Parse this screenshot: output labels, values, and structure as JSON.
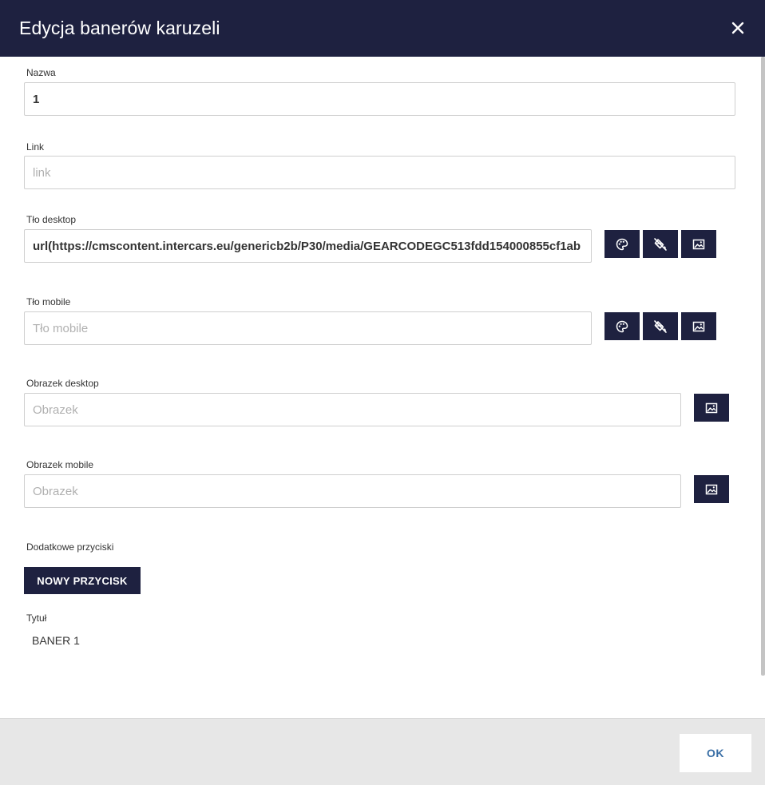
{
  "dialog": {
    "title": "Edycja banerów karuzeli"
  },
  "fields": {
    "nazwa": {
      "label": "Nazwa",
      "value": "1"
    },
    "link": {
      "label": "Link",
      "placeholder": "link"
    },
    "tlo_desktop": {
      "label": "Tło desktop",
      "value": "url(https://cmscontent.intercars.eu/genericb2b/P30/media/GEARCODEGC513fdd154000855cf1ab",
      "buttons": [
        "palette-icon",
        "fill-off-icon",
        "image-icon"
      ]
    },
    "tlo_mobile": {
      "label": "Tło mobile",
      "placeholder": "Tło mobile",
      "buttons": [
        "palette-icon",
        "fill-off-icon",
        "image-icon"
      ]
    },
    "obrazek_desktop": {
      "label": "Obrazek desktop",
      "placeholder": "Obrazek",
      "buttons": [
        "image-icon"
      ]
    },
    "obrazek_mobile": {
      "label": "Obrazek mobile",
      "placeholder": "Obrazek",
      "buttons": [
        "image-icon"
      ]
    }
  },
  "additional_buttons": {
    "label": "Dodatkowe przyciski",
    "new_button_label": "NOWY PRZYCISK"
  },
  "tytul": {
    "label": "Tytuł",
    "value": "BANER 1"
  },
  "footer": {
    "ok_label": "OK"
  },
  "colors": {
    "header": "#1e2140",
    "button": "#1e2140",
    "ok_text": "#3a6fa6",
    "footer_bg": "#e7e7e7"
  }
}
